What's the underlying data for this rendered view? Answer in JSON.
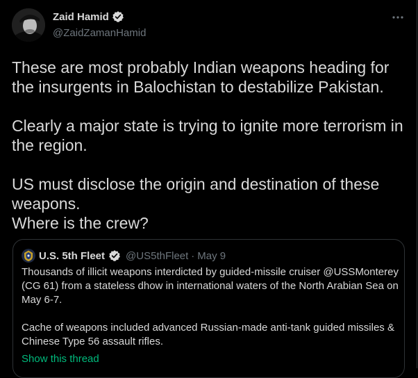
{
  "tweet": {
    "author_name": "Zaid Hamid",
    "author_handle": "@ZaidZamanHamid",
    "paragraphs": [
      "These are most probably Indian weapons heading for the insurgents in Balochistan to destabilize Pakistan.",
      "Clearly a major state is trying to ignite more terrorism in the region.",
      "US must disclose the origin and destination of these weapons.",
      "Where is the crew?"
    ]
  },
  "quoted_tweet": {
    "author_name": "U.S. 5th Fleet",
    "author_handle": "@US5thFleet",
    "separator": "·",
    "date": "May 9",
    "paragraphs": [
      "Thousands of illicit weapons interdicted by guided-missile cruiser @USSMonterey (CG 61) from a stateless dhow in international waters of the North Arabian Sea on May 6-7.",
      "Cache of weapons included advanced Russian-made anti-tank guided missiles & Chinese Type 56 assault rifles."
    ],
    "show_thread_label": "Show this thread"
  },
  "colors": {
    "background": "#000000",
    "text": "#d9d9d9",
    "muted": "#6e767d",
    "border": "#2f3336",
    "verified": "#1d9bf0",
    "link_green": "#00ba7c"
  },
  "icons": {
    "verified": "verified-badge-icon",
    "more": "more-horizontal-icon"
  }
}
